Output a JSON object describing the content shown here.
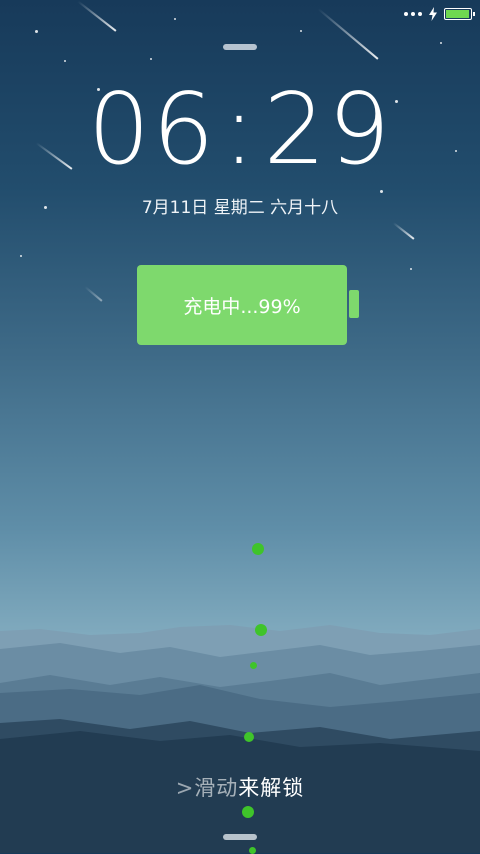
{
  "status_bar": {
    "signal_icon": "dots-icon",
    "charging_icon": "lightning-bolt-icon",
    "battery_icon": "battery-icon",
    "battery_level": 0.99,
    "battery_color": "#6fd851"
  },
  "clock": {
    "h1": "0",
    "h2": "6",
    "sep": ":",
    "m1": "2",
    "m2": "9"
  },
  "date_text": "7月11日 星期二 六月十八",
  "charging": {
    "label": "充电中...99%",
    "color": "#7ed96d"
  },
  "unlock": {
    "arrow": ">",
    "part1": "滑动",
    "part2": "来",
    "part3": "解锁"
  },
  "accent_dot_color": "#3fc42a"
}
